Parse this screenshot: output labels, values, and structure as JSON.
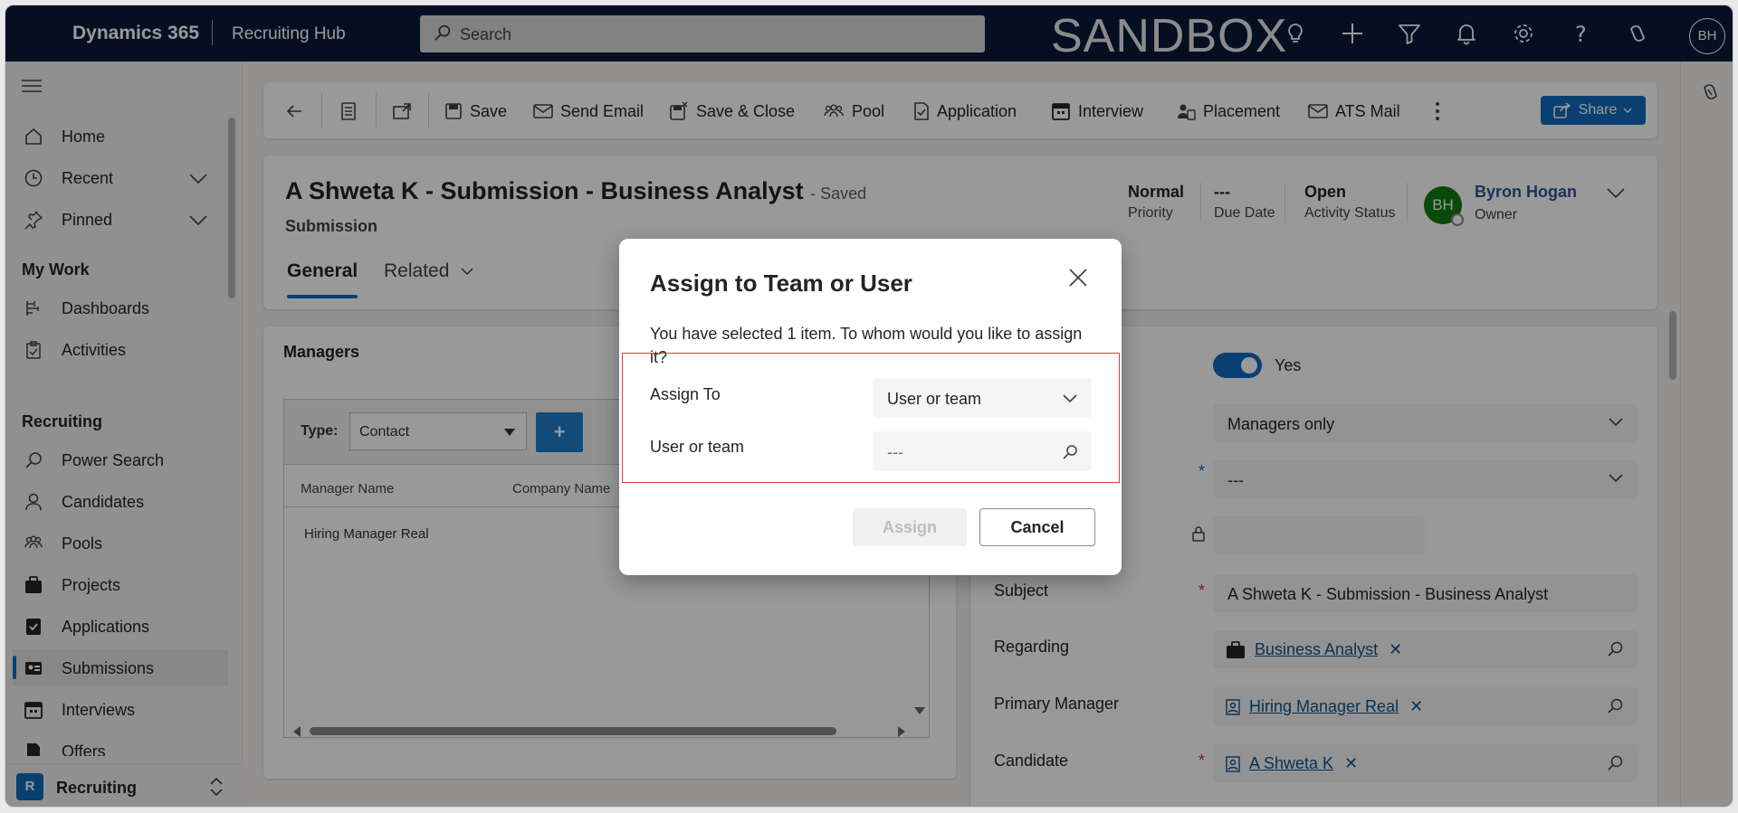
{
  "topbar": {
    "app_name": "Dynamics 365",
    "hub_name": "Recruiting Hub",
    "search_placeholder": "Search",
    "environment": "SANDBOX",
    "user_initials": "BH",
    "icons": [
      "lightbulb-icon",
      "plus-icon",
      "filter-icon",
      "bell-icon",
      "gear-icon",
      "help-icon",
      "copilot-icon"
    ]
  },
  "nav": {
    "items_top": [
      {
        "label": "Home",
        "icon": "home-icon"
      },
      {
        "label": "Recent",
        "icon": "clock-icon"
      },
      {
        "label": "Pinned",
        "icon": "pin-icon"
      }
    ],
    "section_mywork": "My Work",
    "mywork_items": [
      {
        "label": "Dashboards",
        "icon": "dashboard-icon"
      },
      {
        "label": "Activities",
        "icon": "clipboard-icon"
      }
    ],
    "section_recruiting": "Recruiting",
    "recruiting_items": [
      {
        "label": "Power Search",
        "icon": "search-icon"
      },
      {
        "label": "Candidates",
        "icon": "person-icon"
      },
      {
        "label": "Pools",
        "icon": "people-icon"
      },
      {
        "label": "Projects",
        "icon": "briefcase-icon"
      },
      {
        "label": "Applications",
        "icon": "checkdoc-icon"
      },
      {
        "label": "Submissions",
        "icon": "idcard-icon"
      },
      {
        "label": "Interviews",
        "icon": "calendar-icon"
      },
      {
        "label": "Offers",
        "icon": "document-icon"
      }
    ],
    "area": {
      "badge": "R",
      "label": "Recruiting"
    }
  },
  "commands": {
    "save": "Save",
    "send_email": "Send Email",
    "save_close": "Save & Close",
    "pool": "Pool",
    "application": "Application",
    "interview": "Interview",
    "placement": "Placement",
    "ats_mail": "ATS Mail",
    "share": "Share"
  },
  "record": {
    "title": "A Shweta K - Submission - Business Analyst",
    "saved_status": "- Saved",
    "entity": "Submission",
    "tabs": [
      "General",
      "Related"
    ],
    "header_fields": [
      {
        "value": "Normal",
        "label": "Priority"
      },
      {
        "value": "---",
        "label": "Due Date"
      },
      {
        "value": "Open",
        "label": "Activity Status"
      }
    ],
    "owner": {
      "initials": "BH",
      "name": "Byron Hogan",
      "label": "Owner"
    }
  },
  "managers": {
    "heading": "Managers",
    "type_label": "Type:",
    "type_value": "Contact",
    "add_label": "+",
    "columns": [
      "Manager Name",
      "Company Name"
    ],
    "rows": [
      "Hiring Manager Real"
    ]
  },
  "form": {
    "toggle_value": "Yes",
    "visibility_value": "Managers only",
    "empty_select": "---",
    "subject_label": "Subject",
    "subject_value": "A Shweta K - Submission - Business Analyst",
    "regarding_label": "Regarding",
    "regarding_value": "Business Analyst",
    "primary_manager_label": "Primary Manager",
    "primary_manager_value": "Hiring Manager Real",
    "candidate_label": "Candidate",
    "candidate_value": "A Shweta K",
    "required_mark": "*"
  },
  "dialog": {
    "title": "Assign to Team or User",
    "message": "You have selected 1 item. To whom would you like to assign it?",
    "assign_to_label": "Assign To",
    "assign_to_value": "User or team",
    "user_team_label": "User or team",
    "user_team_placeholder": "---",
    "assign_button": "Assign",
    "cancel_button": "Cancel"
  },
  "colors": {
    "topbar_bg": "#0b1a3a",
    "accent": "#0f6cbd",
    "highlight_border": "#e23b3b",
    "owner_avatar": "#107c10"
  }
}
